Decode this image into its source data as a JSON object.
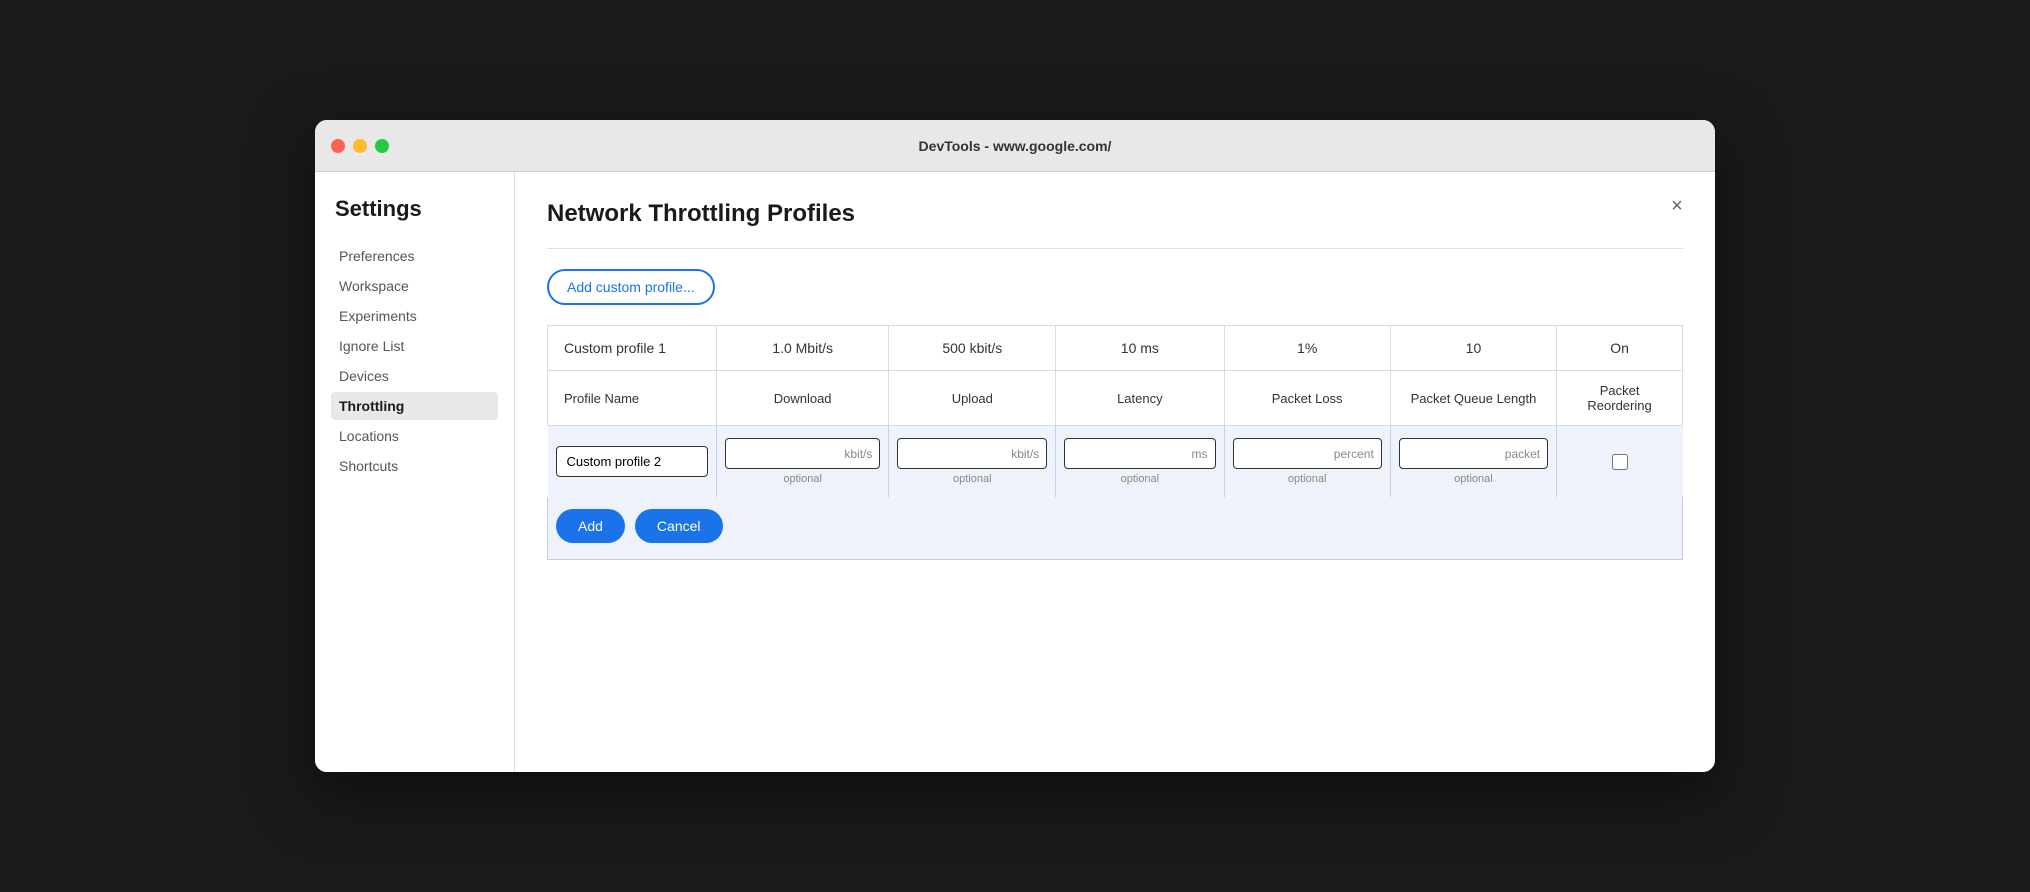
{
  "window": {
    "title": "DevTools - www.google.com/"
  },
  "sidebar": {
    "title": "Settings",
    "items": [
      {
        "id": "preferences",
        "label": "Preferences",
        "active": false
      },
      {
        "id": "workspace",
        "label": "Workspace",
        "active": false
      },
      {
        "id": "experiments",
        "label": "Experiments",
        "active": false
      },
      {
        "id": "ignore-list",
        "label": "Ignore List",
        "active": false
      },
      {
        "id": "devices",
        "label": "Devices",
        "active": false
      },
      {
        "id": "throttling",
        "label": "Throttling",
        "active": true
      },
      {
        "id": "locations",
        "label": "Locations",
        "active": false
      },
      {
        "id": "shortcuts",
        "label": "Shortcuts",
        "active": false
      }
    ]
  },
  "main": {
    "page_title": "Network Throttling Profiles",
    "add_profile_btn": "Add custom profile...",
    "close_label": "×",
    "table": {
      "headers": [
        "Profile Name",
        "Download",
        "Upload",
        "Latency",
        "Packet Loss",
        "Packet Queue Length",
        "Packet Reordering"
      ],
      "existing_profiles": [
        {
          "name": "Custom profile 1",
          "download": "1.0 Mbit/s",
          "upload": "500 kbit/s",
          "latency": "10 ms",
          "packet_loss": "1%",
          "packet_queue": "10",
          "packet_reorder": "On"
        }
      ],
      "new_profile": {
        "name_value": "Custom profile 2",
        "name_placeholder": "",
        "download_placeholder": "kbit/s",
        "download_hint": "optional",
        "upload_placeholder": "kbit/s",
        "upload_hint": "optional",
        "latency_placeholder": "ms",
        "latency_hint": "optional",
        "packet_loss_placeholder": "percent",
        "packet_loss_hint": "optional",
        "packet_queue_placeholder": "packet",
        "packet_queue_hint": "optional"
      }
    },
    "add_btn": "Add",
    "cancel_btn": "Cancel"
  }
}
